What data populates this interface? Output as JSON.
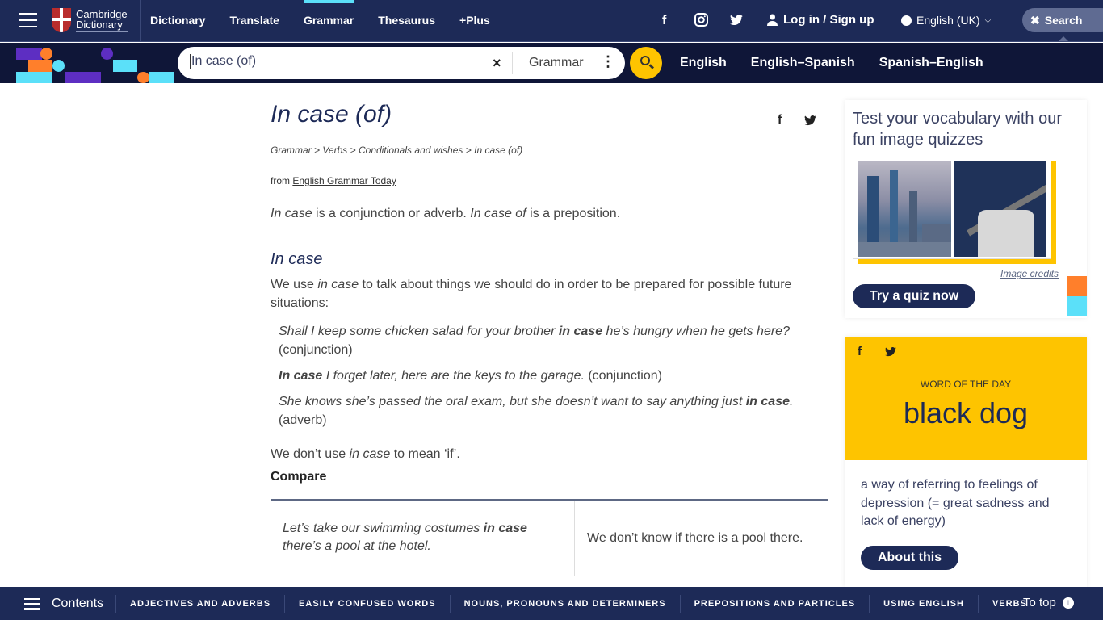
{
  "header": {
    "logo_line1": "Cambridge",
    "logo_line2": "Dictionary",
    "nav": [
      {
        "label": "Dictionary",
        "active": false
      },
      {
        "label": "Translate",
        "active": false
      },
      {
        "label": "Grammar",
        "active": true
      },
      {
        "label": "Thesaurus",
        "active": false
      },
      {
        "label": "+Plus",
        "active": false
      }
    ],
    "social_icons": [
      "facebook-icon",
      "instagram-icon",
      "twitter-icon"
    ],
    "login_label": "Log in / Sign up",
    "language_label": "English (UK)",
    "search_toggle_label": "Search"
  },
  "search": {
    "value": "In case (of)",
    "clear_icon": "×",
    "dictionary_selected": "Grammar",
    "more_icon": "⋮",
    "dictionary_links": [
      "English",
      "English–Spanish",
      "Spanish–English"
    ]
  },
  "article": {
    "title": "In case (of)",
    "breadcrumb": [
      "Grammar",
      "Verbs",
      "Conditionals and wishes",
      "In case (of)"
    ],
    "breadcrumb_separator": ">",
    "from_prefix": "from",
    "from_source": "English Grammar Today",
    "intro": {
      "t1": "In case",
      "t2": " is a conjunction or adverb. ",
      "t3": "In case of",
      "t4": " is a preposition."
    },
    "section_heading": "In case",
    "usage": {
      "t1": "We use ",
      "t2": "in case",
      "t3": " to talk about things we should do in order to be prepared for possible future situations:"
    },
    "examples": [
      {
        "before": "Shall I keep some chicken salad for your brother ",
        "bold": "in case",
        "after": " he’s hungry when he gets here?",
        "tag": " (conjunction)"
      },
      {
        "before": "",
        "bold": "In case",
        "after": " I forget later, here are the keys to the garage.",
        "tag": " (conjunction)"
      },
      {
        "before": "She knows she’s passed the oral exam, but she doesn’t want to say anything just ",
        "bold": "in case",
        "after": ".",
        "tag": " (adverb)"
      }
    ],
    "note": {
      "t1": "We don’t use ",
      "t2": "in case",
      "t3": " to mean ‘if’."
    },
    "compare_label": "Compare",
    "compare_table": {
      "left": {
        "before": "Let’s take our swimming costumes ",
        "bold": "in case",
        "after": " there’s a pool at the hotel."
      },
      "right": "We don’t know if there is a pool there."
    }
  },
  "sidebar": {
    "quiz": {
      "title": "Test your vocabulary with our fun image quizzes",
      "image_credits": "Image credits",
      "button": "Try a quiz now"
    },
    "word_of_the_day": {
      "label": "WORD OF THE DAY",
      "word": "black dog",
      "definition": "a way of referring to feelings of depression (= great sadness and lack of energy)",
      "button": "About this"
    }
  },
  "bottom_bar": {
    "contents_label": "Contents",
    "items": [
      "ADJECTIVES AND ADVERBS",
      "EASILY CONFUSED WORDS",
      "NOUNS, PRONOUNS AND DETERMINERS",
      "PREPOSITIONS AND PARTICLES",
      "USING ENGLISH",
      "VERBS"
    ],
    "to_top_label": "To top"
  },
  "colors": {
    "brand_navy": "#1d2a57",
    "search_bar_bg": "#0f1638",
    "accent_yellow": "#fec400",
    "accent_cyan": "#5be0f9",
    "accent_orange": "#ff7f2b",
    "accent_purple": "#5d2ec2"
  }
}
